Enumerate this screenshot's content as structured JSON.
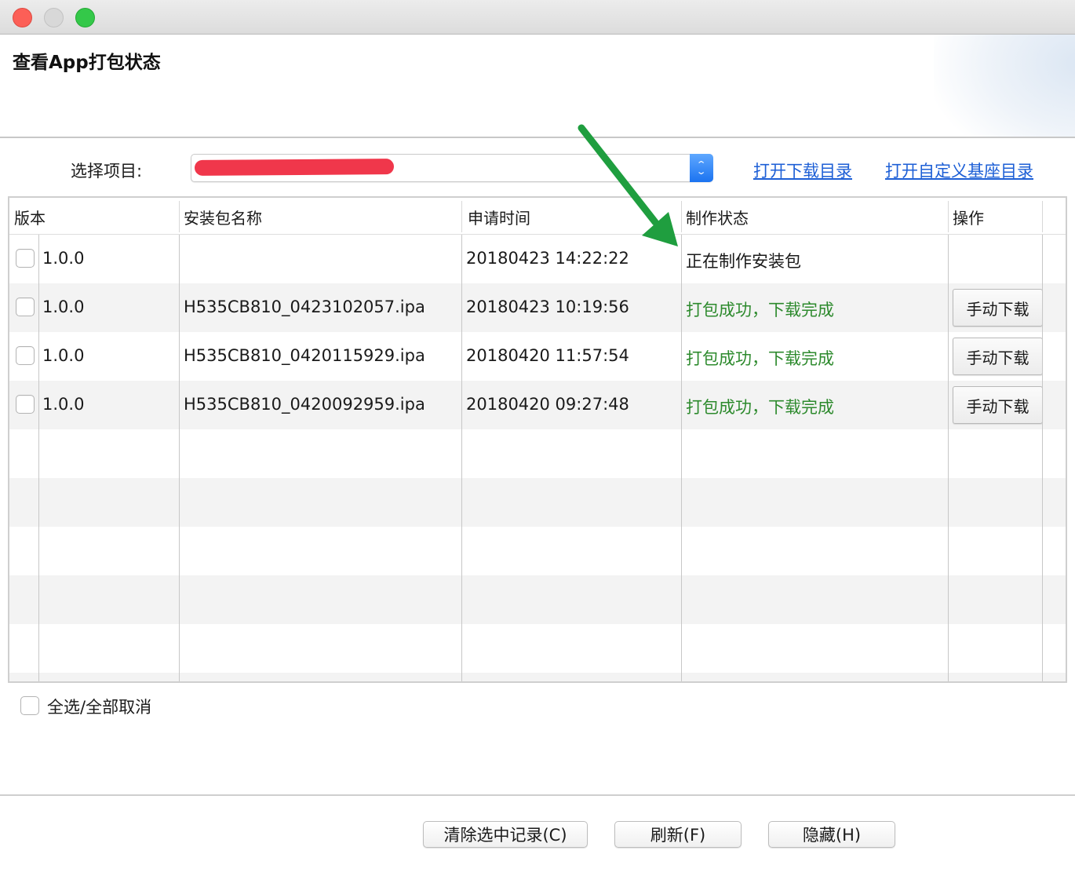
{
  "window": {
    "controls": [
      "close-icon",
      "minimize-icon",
      "maximize-icon"
    ]
  },
  "header": {
    "title": "查看App打包状态"
  },
  "project_select": {
    "label": "选择项目:",
    "value": "",
    "redacted": true,
    "stepper_icon": "up-down-chevron-icon"
  },
  "links": {
    "open_download_dir": "打开下载目录",
    "open_custom_base_dir": "打开自定义基座目录"
  },
  "table": {
    "columns": [
      "版本",
      "安装包名称",
      "申请时间",
      "制作状态",
      "操作"
    ],
    "rows": [
      {
        "version": "1.0.0",
        "package": "",
        "time": "20180423 14:22:22",
        "status": "正在制作安装包",
        "status_color": "#1a1a1a",
        "action": ""
      },
      {
        "version": "1.0.0",
        "package": "H535CB810_0423102057.ipa",
        "time": "20180423 10:19:56",
        "status": "打包成功，下载完成",
        "status_color": "#2d8a2d",
        "action": "手动下载"
      },
      {
        "version": "1.0.0",
        "package": "H535CB810_0420115929.ipa",
        "time": "20180420 11:57:54",
        "status": "打包成功，下载完成",
        "status_color": "#2d8a2d",
        "action": "手动下载"
      },
      {
        "version": "1.0.0",
        "package": "H535CB810_0420092959.ipa",
        "time": "20180420 09:27:48",
        "status": "打包成功，下载完成",
        "status_color": "#2d8a2d",
        "action": "手动下载"
      }
    ]
  },
  "select_all": {
    "label": "全选/全部取消"
  },
  "footer": {
    "clear_label": "清除选中记录(C)",
    "refresh_label": "刷新(F)",
    "hide_label": "隐藏(H)"
  },
  "annotation": {
    "arrow_color": "#1f9e3f",
    "arrow_icon": "green-arrow-icon"
  }
}
